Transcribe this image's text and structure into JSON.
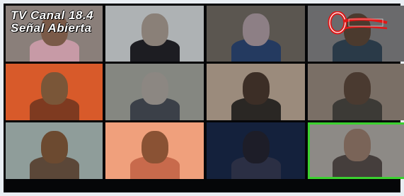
{
  "overlay": {
    "line1": "TV  Canal 18.4",
    "line2": "Señal Abierta"
  },
  "logo": {
    "name": "channel-logo",
    "letter": "O"
  },
  "participants": [
    {
      "bg": "#8a7f7a",
      "head": "#7a5a48",
      "shirt": "#c79aa6",
      "active": false
    },
    {
      "bg": "#aeb2b4",
      "head": "#8a8078",
      "shirt": "#1d1d22",
      "active": false
    },
    {
      "bg": "#5b5650",
      "head": "#8d7f85",
      "shirt": "#243a60",
      "active": false
    },
    {
      "bg": "#6a6a6c",
      "head": "#4b3a2e",
      "shirt": "#2a3a48",
      "active": false
    },
    {
      "bg": "#d85a2a",
      "head": "#7a5638",
      "shirt": "#7e3a20",
      "active": false
    },
    {
      "bg": "#858781",
      "head": "#8c8782",
      "shirt": "#3b4048",
      "active": false
    },
    {
      "bg": "#9b8b7c",
      "head": "#3c2e26",
      "shirt": "#2a2724",
      "active": false
    },
    {
      "bg": "#7a6f66",
      "head": "#4a3a30",
      "shirt": "#3c3a36",
      "active": false
    },
    {
      "bg": "#8f9d9a",
      "head": "#6c4a30",
      "shirt": "#5b4738",
      "active": false
    },
    {
      "bg": "#f0a07c",
      "head": "#8a5234",
      "shirt": "#c86a4c",
      "active": false
    },
    {
      "bg": "#14213c",
      "head": "#1d1d28",
      "shirt": "#2b2f44",
      "active": false
    },
    {
      "bg": "#8d8a86",
      "head": "#7a6458",
      "shirt": "#453e3c",
      "active": true
    }
  ]
}
